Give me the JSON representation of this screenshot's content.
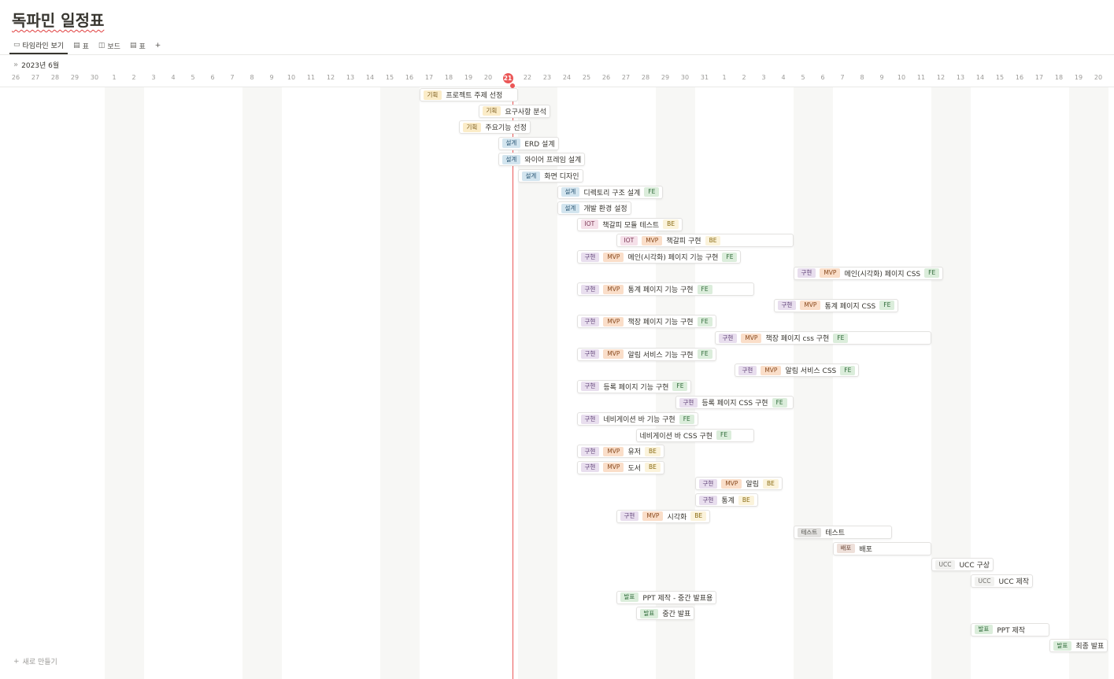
{
  "page": {
    "title": "독파민 일정표"
  },
  "tabs": [
    {
      "label": "타임라인 보기",
      "icon": "timeline-icon",
      "glyph": "▭"
    },
    {
      "label": "표",
      "icon": "table-icon",
      "glyph": "▤"
    },
    {
      "label": "보드",
      "icon": "board-icon",
      "glyph": "◫"
    },
    {
      "label": "표",
      "icon": "table-icon",
      "glyph": "▤"
    }
  ],
  "add_view_label": "+",
  "month_label": "2023년 6월",
  "today_label": "21",
  "days": [
    "26",
    "27",
    "28",
    "29",
    "30",
    "1",
    "2",
    "3",
    "4",
    "5",
    "6",
    "7",
    "8",
    "9",
    "10",
    "11",
    "12",
    "13",
    "14",
    "15",
    "16",
    "17",
    "18",
    "19",
    "20",
    "21",
    "22",
    "23",
    "24",
    "25",
    "26",
    "27",
    "28",
    "29",
    "30",
    "31",
    "1",
    "2",
    "3",
    "4",
    "5",
    "6",
    "7",
    "8",
    "9",
    "10",
    "11",
    "12",
    "13",
    "14",
    "15",
    "16",
    "17",
    "18",
    "19",
    "20"
  ],
  "weekend_start_indices": [
    5,
    12,
    19,
    26,
    33,
    40,
    47,
    54
  ],
  "tag_styles": {
    "기획": "t-plan",
    "설계": "t-design",
    "구현": "t-impl",
    "MVP": "t-mvp",
    "IOT": "t-iot",
    "FE": "t-fe",
    "BE": "t-be",
    "테스트": "t-test",
    "배포": "t-deploy",
    "UCC": "t-ucc",
    "발표": "t-pres"
  },
  "tasks": [
    {
      "name": "프로젝트 주제 선정",
      "start": 21,
      "span": 5,
      "pre": [
        "기획"
      ],
      "post": []
    },
    {
      "name": "요구사항 분석",
      "start": 24,
      "span": 2,
      "pre": [
        "기획"
      ],
      "post": []
    },
    {
      "name": "주요기능 선정",
      "start": 23,
      "span": 3,
      "pre": [
        "기획"
      ],
      "post": []
    },
    {
      "name": "ERD 설계",
      "start": 25,
      "span": 1,
      "pre": [
        "설계"
      ],
      "post": []
    },
    {
      "name": "와이어 프레임 설계",
      "start": 25,
      "span": 1,
      "pre": [
        "설계"
      ],
      "post": []
    },
    {
      "name": "화면 디자인",
      "start": 26,
      "span": 2,
      "pre": [
        "설계"
      ],
      "post": []
    },
    {
      "name": "디렉토리 구조 설계",
      "start": 28,
      "span": 2,
      "pre": [
        "설계"
      ],
      "post": [
        "FE"
      ]
    },
    {
      "name": "개발 환경 설정",
      "start": 28,
      "span": 2,
      "pre": [
        "설계"
      ],
      "post": []
    },
    {
      "name": "책갈피 모듈 테스트",
      "start": 29,
      "span": 2,
      "pre": [
        "IOT"
      ],
      "post": [
        "BE"
      ]
    },
    {
      "name": "책갈피 구현",
      "start": 31,
      "span": 9,
      "pre": [
        "IOT",
        "MVP"
      ],
      "post": [
        "BE"
      ]
    },
    {
      "name": "메인(시각화) 페이지 기능 구현",
      "start": 29,
      "span": 8,
      "pre": [
        "구현",
        "MVP"
      ],
      "post": [
        "FE"
      ]
    },
    {
      "name": "메인(시각화) 페이지 CSS",
      "start": 40,
      "span": 7,
      "pre": [
        "구현",
        "MVP"
      ],
      "post": [
        "FE"
      ]
    },
    {
      "name": "통계 페이지 기능 구현",
      "start": 29,
      "span": 9,
      "pre": [
        "구현",
        "MVP"
      ],
      "post": [
        "FE"
      ]
    },
    {
      "name": "통계 페이지 CSS",
      "start": 39,
      "span": 5,
      "pre": [
        "구현",
        "MVP"
      ],
      "post": [
        "FE"
      ]
    },
    {
      "name": "책장 페이지 기능 구현",
      "start": 29,
      "span": 7,
      "pre": [
        "구현",
        "MVP"
      ],
      "post": [
        "FE"
      ]
    },
    {
      "name": "책장 페이지 css 구현",
      "start": 36,
      "span": 11,
      "pre": [
        "구현",
        "MVP"
      ],
      "post": [
        "FE"
      ]
    },
    {
      "name": "알림 서비스 기능 구현",
      "start": 29,
      "span": 7,
      "pre": [
        "구현",
        "MVP"
      ],
      "post": [
        "FE"
      ]
    },
    {
      "name": "알림 서비스 CSS",
      "start": 37,
      "span": 5,
      "pre": [
        "구현",
        "MVP"
      ],
      "post": [
        "FE"
      ]
    },
    {
      "name": "등록 페이지 기능 구현",
      "start": 29,
      "span": 5,
      "pre": [
        "구현"
      ],
      "post": [
        "FE"
      ]
    },
    {
      "name": "등록 페이지 CSS 구현",
      "start": 34,
      "span": 6,
      "pre": [
        "구현"
      ],
      "post": [
        "FE"
      ]
    },
    {
      "name": "네비게이션 바 기능 구현",
      "start": 29,
      "span": 6,
      "pre": [
        "구현"
      ],
      "post": [
        "FE"
      ]
    },
    {
      "name": "네비게이션 바 CSS 구현",
      "start": 32,
      "span": 6,
      "pre": [],
      "post": [
        "FE"
      ]
    },
    {
      "name": "유저",
      "start": 29,
      "span": 4,
      "pre": [
        "구현",
        "MVP"
      ],
      "post": [
        "BE"
      ]
    },
    {
      "name": "도서",
      "start": 29,
      "span": 4,
      "pre": [
        "구현",
        "MVP"
      ],
      "post": [
        "BE"
      ]
    },
    {
      "name": "알림",
      "start": 35,
      "span": 4,
      "pre": [
        "구현",
        "MVP"
      ],
      "post": [
        "BE"
      ]
    },
    {
      "name": "통계",
      "start": 35,
      "span": 3,
      "pre": [
        "구현"
      ],
      "post": [
        "BE"
      ]
    },
    {
      "name": "시각화",
      "start": 31,
      "span": 3,
      "pre": [
        "구현",
        "MVP"
      ],
      "post": [
        "BE"
      ]
    },
    {
      "name": "테스트",
      "start": 40,
      "span": 5,
      "pre": [
        "테스트"
      ],
      "post": []
    },
    {
      "name": "배포",
      "start": 42,
      "span": 5,
      "pre": [
        "배포"
      ],
      "post": []
    },
    {
      "name": "UCC 구상",
      "start": 47,
      "span": 2,
      "pre": [
        "UCC"
      ],
      "post": []
    },
    {
      "name": "UCC 제작",
      "start": 49,
      "span": 2,
      "pre": [
        "UCC"
      ],
      "post": []
    },
    {
      "name": "PPT 제작 - 중간 발표용",
      "start": 31,
      "span": 2,
      "pre": [
        "발표"
      ],
      "post": []
    },
    {
      "name": "중간 발표",
      "start": 32,
      "span": 1,
      "pre": [
        "발표"
      ],
      "post": []
    },
    {
      "name": "PPT 제작",
      "start": 49,
      "span": 4,
      "pre": [
        "발표"
      ],
      "post": []
    },
    {
      "name": "최종 발표",
      "start": 53,
      "span": 1,
      "pre": [
        "발표"
      ],
      "post": []
    }
  ],
  "new_label": "새로 만들기"
}
